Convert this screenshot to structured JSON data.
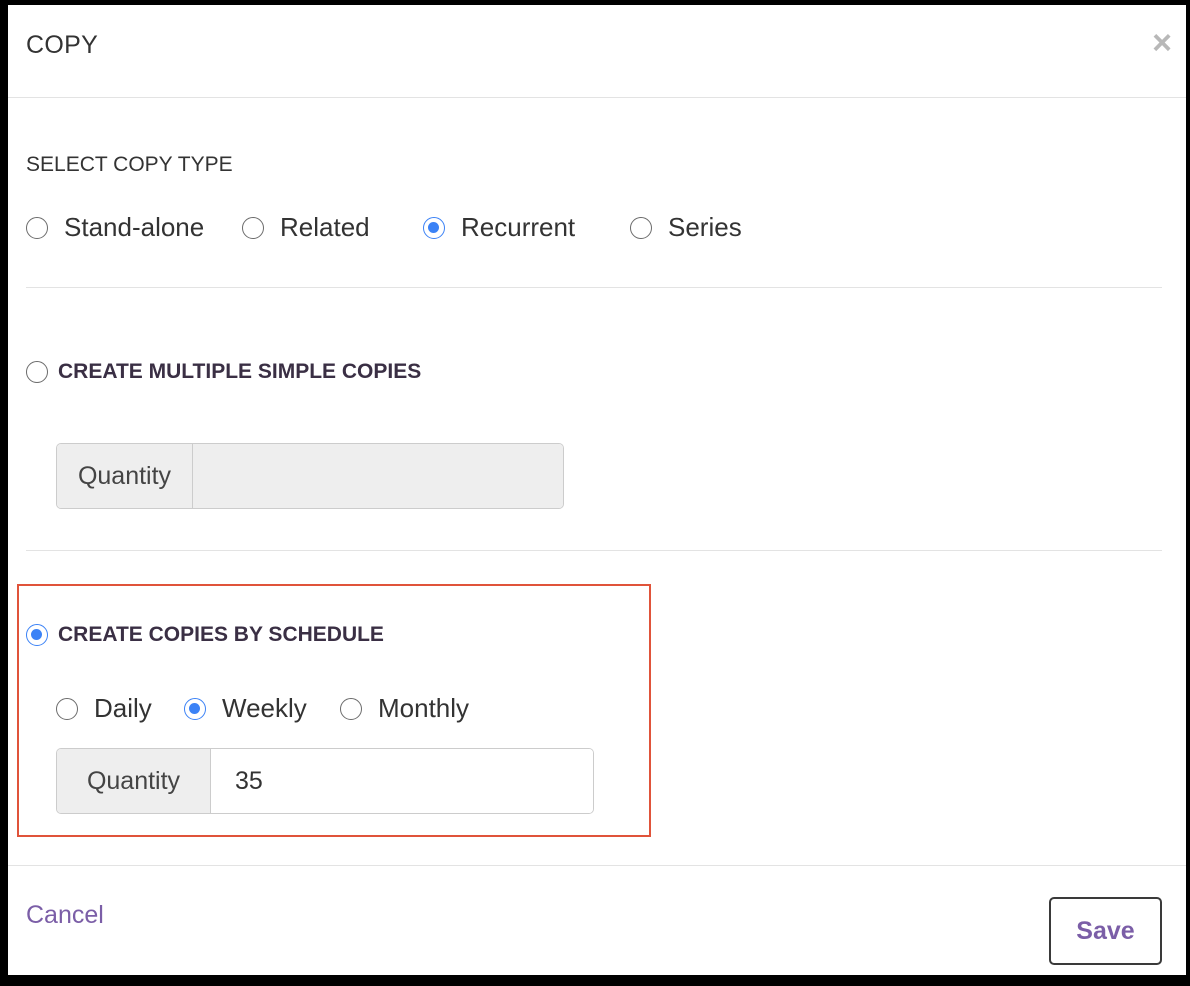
{
  "dialog": {
    "title": "COPY",
    "close_symbol": "×"
  },
  "copy_type": {
    "label": "SELECT COPY TYPE",
    "options": [
      {
        "label": "Stand-alone",
        "checked": false
      },
      {
        "label": "Related",
        "checked": false
      },
      {
        "label": "Recurrent",
        "checked": true
      },
      {
        "label": "Series",
        "checked": false
      }
    ]
  },
  "simple_copies": {
    "heading": "CREATE MULTIPLE SIMPLE COPIES",
    "checked": false,
    "quantity_label": "Quantity",
    "quantity_value": ""
  },
  "schedule_copies": {
    "heading": "CREATE COPIES BY SCHEDULE",
    "checked": true,
    "frequency_options": [
      {
        "label": "Daily",
        "checked": false
      },
      {
        "label": "Weekly",
        "checked": true
      },
      {
        "label": "Monthly",
        "checked": false
      }
    ],
    "quantity_label": "Quantity",
    "quantity_value": "35"
  },
  "footer": {
    "cancel_label": "Cancel",
    "save_label": "Save"
  },
  "colors": {
    "accent": "#3b82f6",
    "link": "#7b5ea7",
    "highlight": "#e0533a"
  },
  "icons": {
    "close": "close-icon"
  }
}
